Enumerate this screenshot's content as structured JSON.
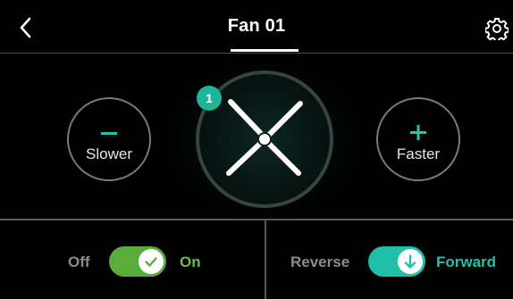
{
  "header": {
    "title": "Fan 01",
    "back_icon": "chevron-left-icon",
    "settings_icon": "gear-icon"
  },
  "controls": {
    "slower": {
      "symbol": "−",
      "label": "Slower"
    },
    "faster": {
      "symbol": "+",
      "label": "Faster"
    },
    "speed_level": "1",
    "fan_icon": "fan-blades-icon"
  },
  "power": {
    "off_label": "Off",
    "on_label": "On",
    "state": "on",
    "knob_icon": "check-icon"
  },
  "direction": {
    "reverse_label": "Reverse",
    "forward_label": "Forward",
    "state": "forward",
    "knob_icon": "arrow-down-icon"
  },
  "colors": {
    "accent_teal": "#1fc0a7",
    "power_green": "#5aad3b",
    "background": "#000000"
  }
}
